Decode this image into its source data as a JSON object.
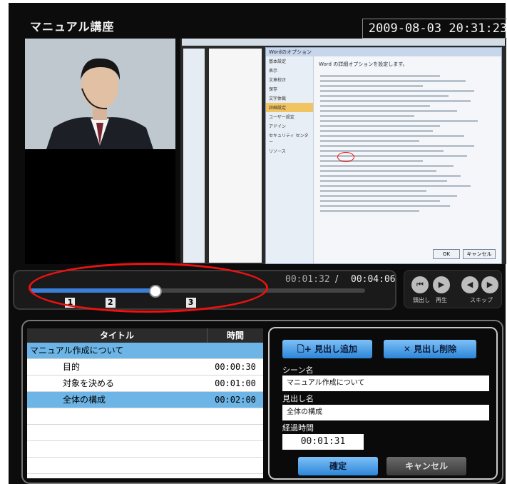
{
  "app": {
    "title": "マニュアル講座",
    "datetime": "2009-08-03 20:31:23"
  },
  "slide": {
    "dialog_title": "Wordのオプション",
    "dialog_header": "Word の詳細オプションを設定します。",
    "menu": [
      "基本設定",
      "表示",
      "文章校正",
      "保存",
      "文字体裁",
      "詳細設定",
      "ユーザー設定",
      "アドイン",
      "セキュリティ センター",
      "リソース"
    ],
    "selected_menu": "詳細設定",
    "ok": "OK",
    "cancel": "キャンセル"
  },
  "player": {
    "current_time": "00:01:32",
    "separator": "/",
    "total_time": "00:04:06",
    "progress": 0.37,
    "markers": [
      {
        "label": "1",
        "pos": 0.12
      },
      {
        "label": "2",
        "pos": 0.24
      },
      {
        "label": "3",
        "pos": 0.48
      }
    ],
    "controls": {
      "prev_label": "頭出し",
      "play_label": "再生",
      "skip_label": "スキップ"
    }
  },
  "table": {
    "headers": {
      "title": "タイトル",
      "time": "時間"
    },
    "rows": [
      {
        "title": "マニュアル作成について",
        "time": "",
        "indent": false,
        "highlight": true
      },
      {
        "title": "目的",
        "time": "00:00:30",
        "indent": true,
        "highlight": false
      },
      {
        "title": "対象を決める",
        "time": "00:01:00",
        "indent": true,
        "highlight": false
      },
      {
        "title": "全体の構成",
        "time": "00:02:00",
        "indent": true,
        "highlight": true
      },
      {
        "title": "",
        "time": "",
        "indent": false,
        "highlight": false
      },
      {
        "title": "",
        "time": "",
        "indent": false,
        "highlight": false
      },
      {
        "title": "",
        "time": "",
        "indent": false,
        "highlight": false
      },
      {
        "title": "",
        "time": "",
        "indent": false,
        "highlight": false
      }
    ]
  },
  "panel": {
    "add_heading": "見出し追加",
    "delete_heading": "見出し削除",
    "scene_label": "シーン名",
    "scene_value": "マニュアル作成について",
    "heading_label": "見出し名",
    "heading_value": "全体の構成",
    "elapsed_label": "経過時間",
    "elapsed_value": "00:01:31",
    "confirm": "確定",
    "cancel": "キャンセル"
  }
}
